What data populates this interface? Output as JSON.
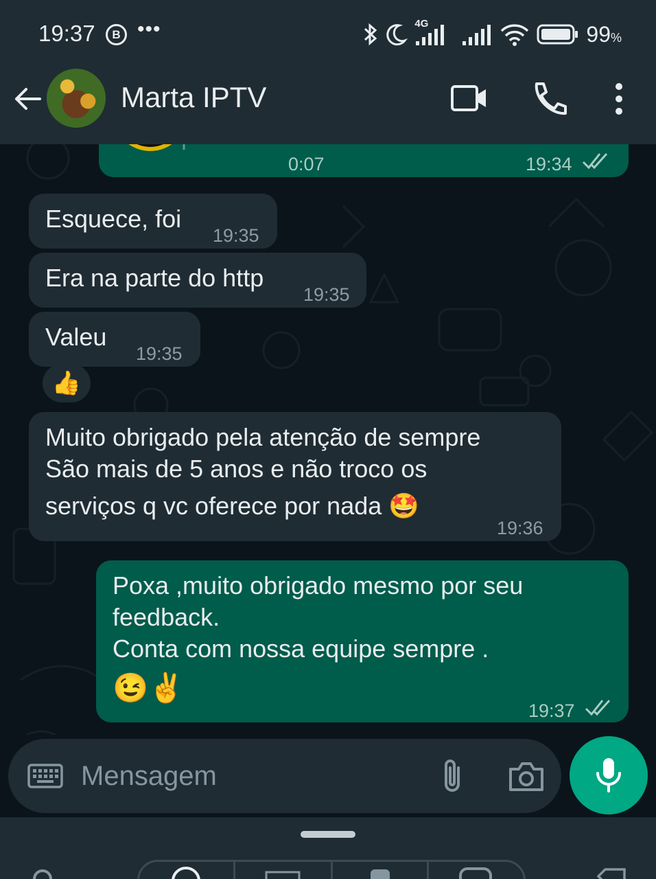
{
  "status_bar": {
    "time": "19:37",
    "b_icon": "B",
    "dots": "•••",
    "battery": "99",
    "battery_unit": "%",
    "net_label": "4G",
    "icons": [
      "bluetooth-icon",
      "moon-icon",
      "signal-icon",
      "signal-icon",
      "wifi-icon",
      "battery-icon"
    ]
  },
  "header": {
    "contact_name": "Marta IPTV",
    "icons": [
      "back-arrow-icon",
      "video-call-icon",
      "phone-icon",
      "more-vert-icon"
    ]
  },
  "chat": {
    "voice_message": {
      "duration": "0:07",
      "time": "19:34"
    },
    "messages": [
      {
        "direction": "in",
        "text": "Esquece, foi",
        "time": "19:35"
      },
      {
        "direction": "in",
        "text": "Era na parte do http",
        "time": "19:35"
      },
      {
        "direction": "in",
        "text": "Valeu",
        "time": "19:35",
        "reaction": "👍"
      },
      {
        "direction": "in",
        "lines": [
          "Muito obrigado pela atenção de sempre",
          "São mais de 5 anos e não troco os",
          "serviços q vc oferece por nada 🤩"
        ],
        "time": "19:36"
      },
      {
        "direction": "out",
        "lines": [
          "Poxa ,muito obrigado mesmo por seu",
          "feedback.",
          "Conta com nossa equipe sempre .",
          "😉✌️"
        ],
        "time": "19:37"
      }
    ]
  },
  "input": {
    "placeholder": "Mensagem",
    "icons": [
      "keyboard-icon",
      "attach-icon",
      "camera-icon",
      "mic-icon"
    ]
  },
  "colors": {
    "bg": "#0b141a",
    "bar": "#1f2c34",
    "incoming": "#1f2c34",
    "outgoing": "#005c4b",
    "accent": "#00a884",
    "read_tick": "#a9cdc4"
  }
}
